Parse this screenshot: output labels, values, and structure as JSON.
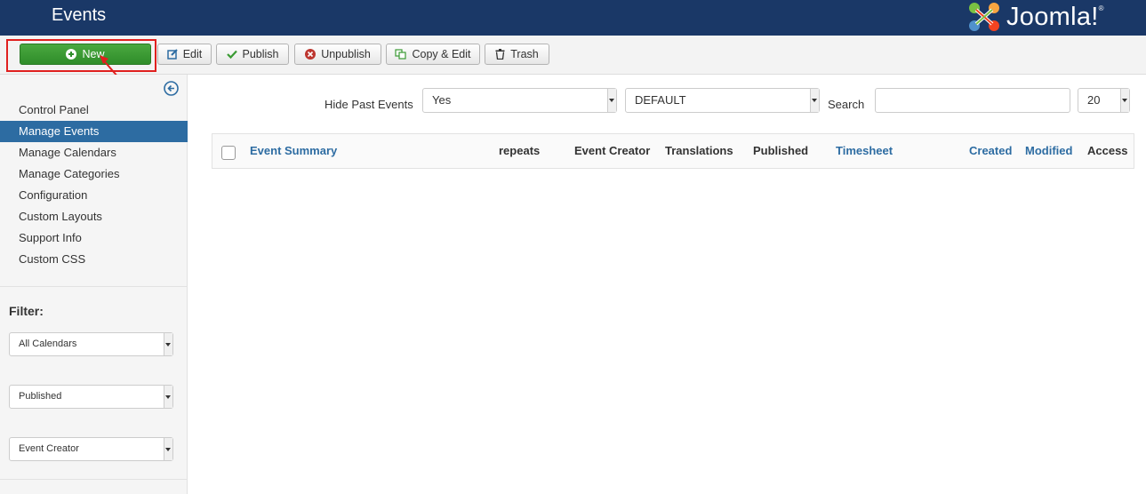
{
  "header": {
    "title": "Events",
    "logo_text": "Joomla!",
    "logo_reg": "®"
  },
  "toolbar": {
    "new_label": "New",
    "edit_label": "Edit",
    "publish_label": "Publish",
    "unpublish_label": "Unpublish",
    "copy_edit_label": "Copy & Edit",
    "trash_label": "Trash"
  },
  "sidebar": {
    "items": [
      {
        "label": "Control Panel"
      },
      {
        "label": "Manage Events"
      },
      {
        "label": "Manage Calendars"
      },
      {
        "label": "Manage Categories"
      },
      {
        "label": "Configuration"
      },
      {
        "label": "Custom Layouts"
      },
      {
        "label": "Support Info"
      },
      {
        "label": "Custom CSS"
      }
    ],
    "active_index": 1,
    "filter_label": "Filter:",
    "filters": [
      "All Calendars",
      "Published",
      "Event Creator"
    ]
  },
  "filters_bar": {
    "hide_past_label": "Hide Past Events",
    "hide_past_value": "Yes",
    "layout_value": "DEFAULT",
    "search_label": "Search",
    "search_value": "",
    "limit_value": "20"
  },
  "table": {
    "columns": [
      "Event Summary",
      "repeats",
      "Event Creator",
      "Translations",
      "Published",
      "Timesheet",
      "Created",
      "Modified",
      "Access"
    ]
  },
  "colors": {
    "header_bg": "#1a3867",
    "active_nav": "#2d6ca2",
    "new_button": "#3a9a33",
    "highlight": "#e0201f",
    "link": "#2d6ca2"
  }
}
